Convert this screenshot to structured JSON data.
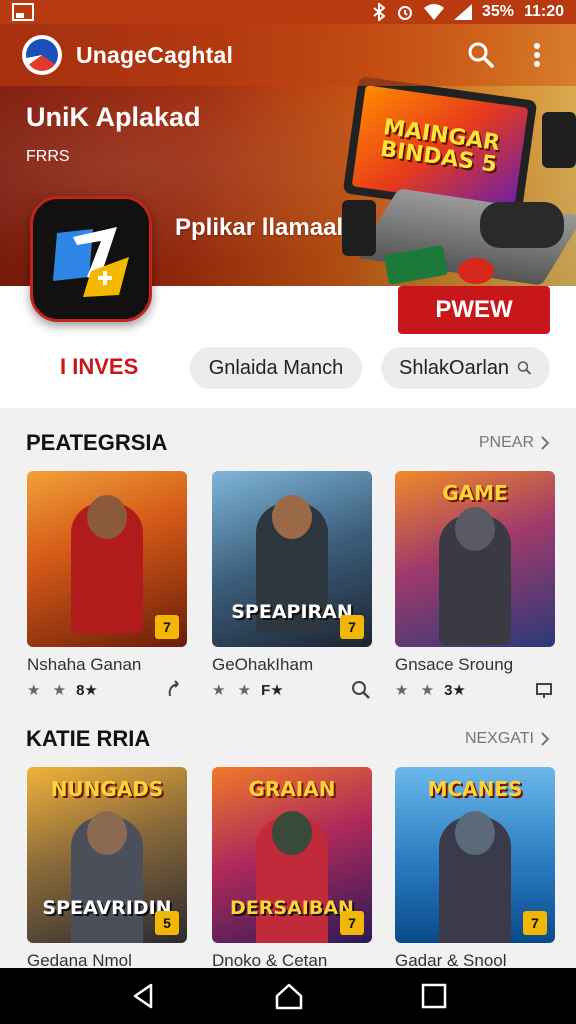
{
  "status_bar": {
    "battery": "35%",
    "time": "11:20"
  },
  "app_bar": {
    "title": "UnageCaghtal",
    "icons": [
      "app-logo-icon",
      "search-icon",
      "more-vert-icon"
    ]
  },
  "hero": {
    "title": "UniK Aplakad",
    "subtitle": "FRRS",
    "tagline": "Pplikar llamaal",
    "screen_text": "MAINGAR BINDAS 5",
    "new_button": "PWEW"
  },
  "filters": {
    "main_tab": "I INVES",
    "chip_1": "Gnlaida Manch",
    "chip_2": "ShlakOarlan"
  },
  "sections": [
    {
      "title": "PEATEGRSIA",
      "more": "PNEAR",
      "cards": [
        {
          "name": "Nshaha Ganan",
          "stars": "★ ★",
          "rating": "8★",
          "action_icon": "swipe-icon",
          "thumb_text": "",
          "badge": "7"
        },
        {
          "name": "GeOhakIham",
          "stars": "★ ★",
          "rating": "F★",
          "action_icon": "search-icon",
          "thumb_text": "SPEAPIRAN",
          "badge": "7"
        },
        {
          "name": "Gnsace Sroung",
          "stars": "★ ★",
          "rating": "3★",
          "action_icon": "device-icon",
          "thumb_text": "GAME",
          "badge": ""
        }
      ]
    },
    {
      "title": "KATIE RRIA",
      "more": "NEXGATI",
      "cards": [
        {
          "name": "Gedana Nmol",
          "thumb_top": "NUNGADS",
          "thumb_text": "SPEAVRIDIN",
          "badge": "5"
        },
        {
          "name": "Dnoko & Cetan",
          "thumb_top": "GRAIAN",
          "thumb_text": "DERSAIBAN",
          "badge": "7"
        },
        {
          "name": "Gadar & Snool",
          "thumb_top": "MCANES",
          "thumb_text": "",
          "badge": "7"
        }
      ]
    }
  ],
  "nav": {
    "icons": [
      "back-icon",
      "home-icon",
      "recents-icon"
    ]
  },
  "colors": {
    "accent": "#c8171b",
    "header_start": "#8a1d0f",
    "header_end": "#f2c76a"
  }
}
